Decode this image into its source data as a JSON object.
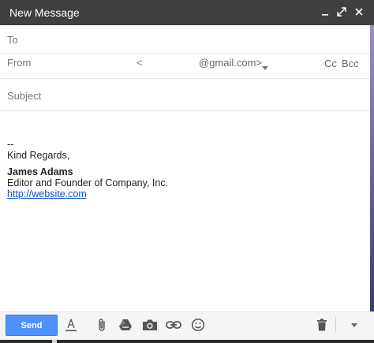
{
  "window": {
    "title": "New Message"
  },
  "fields": {
    "to_label": "To",
    "from_label": "From",
    "from_prefix": "<",
    "from_email": "@gmail.com>",
    "cc": "Cc",
    "bcc": "Bcc",
    "subject_placeholder": "Subject"
  },
  "signature": {
    "separator": "--",
    "closing": "Kind Regards,",
    "name": "James Adams",
    "position": "Editor and Founder of Company, Inc.",
    "link": "http://website.com"
  },
  "toolbar": {
    "send_label": "Send",
    "icons": [
      "formatting-icon",
      "attach-icon",
      "drive-icon",
      "photo-icon",
      "link-icon",
      "emoji-icon",
      "trash-icon",
      "more-options-icon"
    ]
  },
  "colors": {
    "titlebar": "#404040",
    "send": "#4d90fe",
    "link": "#1155cc"
  }
}
